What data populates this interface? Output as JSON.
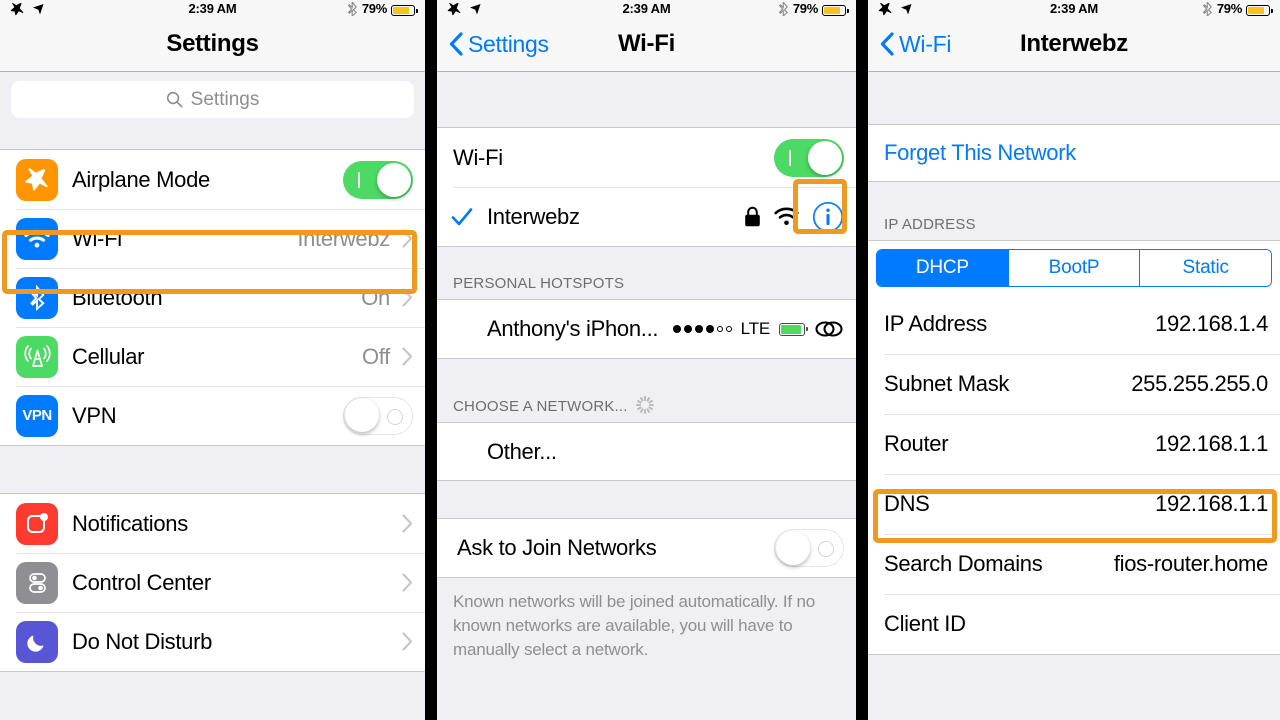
{
  "status_bar": {
    "time": "2:39 AM",
    "battery_percent": "79%",
    "icons": [
      "airplane-icon",
      "location-icon",
      "bluetooth-icon",
      "battery-icon"
    ]
  },
  "panel_settings": {
    "title": "Settings",
    "search": {
      "placeholder": "Settings",
      "value": "",
      "icon": "search-icon"
    },
    "group_connectivity": [
      {
        "icon": "airplane-icon",
        "label": "Airplane Mode",
        "control": "toggle",
        "toggle_state": "on"
      },
      {
        "icon": "wifi-icon",
        "label": "Wi-Fi",
        "value": "Interwebz",
        "control": "chevron",
        "highlighted": true
      },
      {
        "icon": "bluetooth-icon",
        "label": "Bluetooth",
        "value": "On",
        "control": "chevron"
      },
      {
        "icon": "cellular-icon",
        "label": "Cellular",
        "value": "Off",
        "control": "chevron"
      },
      {
        "icon": "vpn-icon",
        "label": "VPN",
        "control": "toggle",
        "toggle_state": "off"
      }
    ],
    "group_system": [
      {
        "icon": "notifications-icon",
        "label": "Notifications",
        "control": "chevron"
      },
      {
        "icon": "control-center-icon",
        "label": "Control Center",
        "control": "chevron"
      },
      {
        "icon": "do-not-disturb-icon",
        "label": "Do Not Disturb",
        "control": "chevron"
      }
    ]
  },
  "panel_wifi": {
    "back_label": "Settings",
    "title": "Wi-Fi",
    "wifi_toggle": {
      "label": "Wi-Fi",
      "state": "on"
    },
    "connected_network": {
      "name": "Interwebz",
      "checked": true,
      "secured": true,
      "signal": "wifi-signal-icon",
      "info_button": "info-icon",
      "highlighted": true
    },
    "personal_hotspots_header": "PERSONAL HOTSPOTS",
    "hotspots": [
      {
        "name": "Anthony's iPhon...",
        "signal_bars_filled": 4,
        "signal_bars_total": 6,
        "network_type": "LTE",
        "battery": "battery-icon",
        "link": "chain-link-icon"
      }
    ],
    "choose_network_header": "CHOOSE A NETWORK...",
    "choose_network_spinner": true,
    "networks": [
      {
        "name": "Other..."
      }
    ],
    "ask_to_join": {
      "label": "Ask to Join Networks",
      "state": "off"
    },
    "footnote": "Known networks will be joined automatically. If no known networks are available, you will have to manually select a network."
  },
  "panel_network": {
    "back_label": "Wi-Fi",
    "title": "Interwebz",
    "forget_label": "Forget This Network",
    "ip_address_header": "IP ADDRESS",
    "segments": [
      {
        "label": "DHCP",
        "active": true
      },
      {
        "label": "BootP",
        "active": false
      },
      {
        "label": "Static",
        "active": false
      }
    ],
    "fields": [
      {
        "key": "IP Address",
        "value": "192.168.1.4"
      },
      {
        "key": "Subnet Mask",
        "value": "255.255.255.0"
      },
      {
        "key": "Router",
        "value": "192.168.1.1"
      },
      {
        "key": "DNS",
        "value": "192.168.1.1",
        "highlighted": true
      },
      {
        "key": "Search Domains",
        "value": "fios-router.home"
      },
      {
        "key": "Client ID",
        "value": ""
      }
    ]
  },
  "colors": {
    "highlight_orange": "#f0981f",
    "ios_blue": "#007aff",
    "ios_green": "#4cd964",
    "group_bg": "#efeff4"
  }
}
